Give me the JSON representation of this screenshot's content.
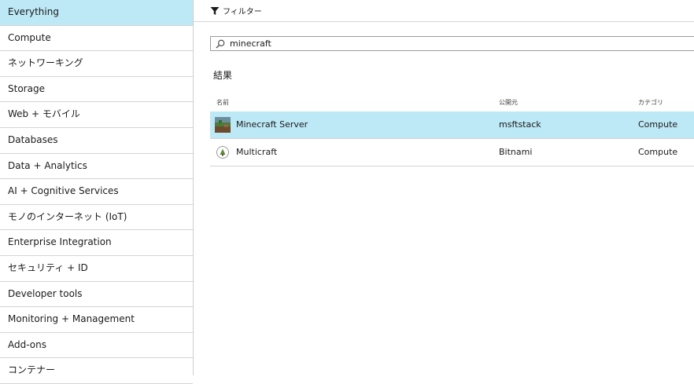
{
  "sidebar": {
    "items": [
      {
        "label": "Everything",
        "active": true
      },
      {
        "label": "Compute"
      },
      {
        "label": "ネットワーキング"
      },
      {
        "label": "Storage"
      },
      {
        "label": "Web + モバイル"
      },
      {
        "label": "Databases"
      },
      {
        "label": "Data + Analytics"
      },
      {
        "label": "AI + Cognitive Services"
      },
      {
        "label": "モノのインターネット (IoT)"
      },
      {
        "label": "Enterprise Integration"
      },
      {
        "label": "セキュリティ + ID"
      },
      {
        "label": "Developer tools"
      },
      {
        "label": "Monitoring + Management"
      },
      {
        "label": "Add-ons"
      },
      {
        "label": "コンテナー"
      }
    ]
  },
  "toolbar": {
    "filter_label": "フィルター",
    "filter_icon": "funnel-icon"
  },
  "search": {
    "value": "minecraft",
    "icon": "search-icon"
  },
  "results": {
    "title": "結果",
    "columns": {
      "name": "名前",
      "publisher": "公開元",
      "category": "カテゴリ"
    },
    "rows": [
      {
        "name": "Minecraft Server",
        "publisher": "msftstack",
        "category": "Compute",
        "selected": true,
        "icon": "minecraft-thumbnail-icon"
      },
      {
        "name": "Multicraft",
        "publisher": "Bitnami",
        "category": "Compute",
        "selected": false,
        "icon": "bitnami-icon"
      }
    ]
  },
  "colors": {
    "selected": "#bde8f5",
    "border": "#d4d4d4"
  }
}
